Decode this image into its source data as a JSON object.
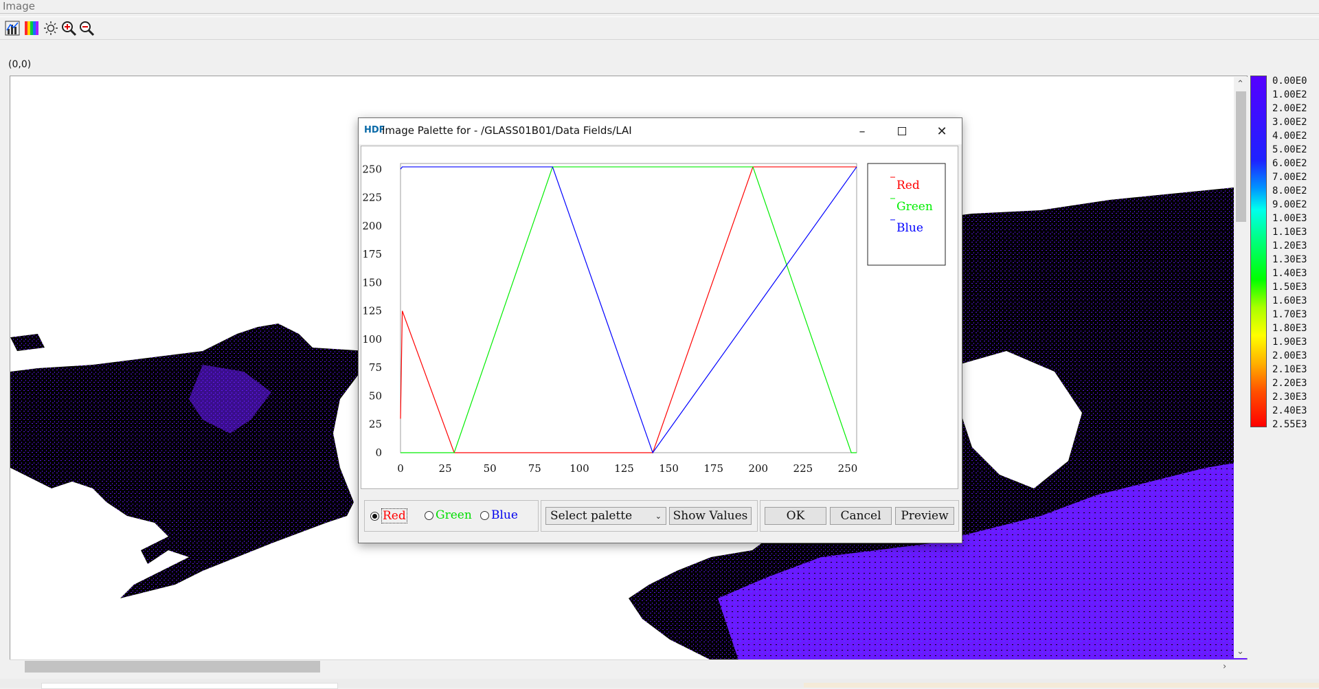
{
  "window": {
    "title": "Image"
  },
  "toolbar": {
    "items": [
      {
        "name": "histogram-icon"
      },
      {
        "name": "palette-icon"
      },
      {
        "name": "brightness-icon"
      },
      {
        "name": "zoom-in-icon"
      },
      {
        "name": "zoom-out-icon"
      }
    ]
  },
  "coordinate_readout": "(0,0)",
  "colorbar": {
    "labels": [
      "0.00E0",
      "1.00E2",
      "2.00E2",
      "3.00E2",
      "4.00E2",
      "5.00E2",
      "6.00E2",
      "7.00E2",
      "8.00E2",
      "9.00E2",
      "1.00E3",
      "1.10E3",
      "1.20E3",
      "1.30E3",
      "1.40E3",
      "1.50E3",
      "1.60E3",
      "1.70E3",
      "1.80E3",
      "1.90E3",
      "2.00E3",
      "2.10E3",
      "2.20E3",
      "2.30E3",
      "2.40E3",
      "2.55E3"
    ]
  },
  "dialog": {
    "title": "Image Palette for - /GLASS01B01/Data Fields/LAI",
    "logo": "HDF",
    "controls": {
      "radio_red": "Red",
      "radio_green": "Green",
      "radio_blue": "Blue",
      "select_palette": "Select palette",
      "show_values": "Show Values",
      "ok": "OK",
      "cancel": "Cancel",
      "preview": "Preview"
    }
  },
  "colors": {
    "red": "#ff0000",
    "green": "#00ee00",
    "blue": "#0000ff",
    "map_land": "#000000",
    "map_veg": "#6a1aff"
  },
  "chart_data": {
    "type": "line",
    "xlim": [
      0,
      255
    ],
    "ylim": [
      0,
      255
    ],
    "x_ticks": [
      0,
      25,
      50,
      75,
      100,
      125,
      150,
      175,
      200,
      225,
      250
    ],
    "y_ticks": [
      0,
      25,
      50,
      75,
      100,
      125,
      150,
      175,
      200,
      225,
      250
    ],
    "legend_position": "right",
    "series": [
      {
        "name": "Red",
        "x": [
          0,
          1,
          30,
          141,
          197,
          255
        ],
        "y": [
          30,
          125,
          0,
          0,
          252,
          252
        ]
      },
      {
        "name": "Green",
        "x": [
          0,
          30,
          85,
          197,
          252,
          255
        ],
        "y": [
          0,
          0,
          252,
          252,
          0,
          0
        ]
      },
      {
        "name": "Blue",
        "x": [
          0,
          1,
          85,
          141,
          255
        ],
        "y": [
          250,
          252,
          252,
          0,
          252
        ]
      }
    ]
  }
}
